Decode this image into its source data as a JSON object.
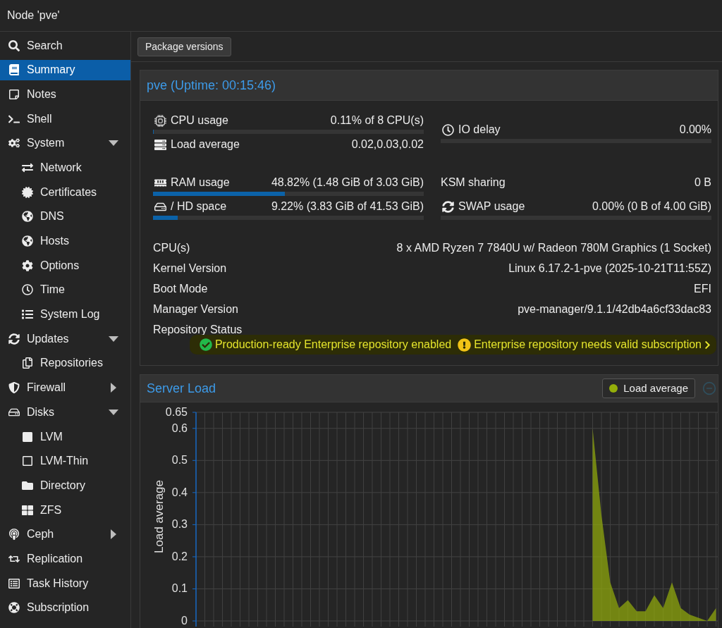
{
  "window": {
    "title": "Node 'pve'"
  },
  "sidebar": {
    "items": [
      {
        "label": "Search",
        "selected": false
      },
      {
        "label": "Summary",
        "selected": true
      },
      {
        "label": "Notes",
        "selected": false
      },
      {
        "label": "Shell",
        "selected": false
      },
      {
        "label": "System",
        "selected": false,
        "expanded": true,
        "children": [
          {
            "label": "Network",
            "selected": false
          },
          {
            "label": "Certificates",
            "selected": false
          },
          {
            "label": "DNS",
            "selected": false
          },
          {
            "label": "Hosts",
            "selected": false
          },
          {
            "label": "Options",
            "selected": false
          },
          {
            "label": "Time",
            "selected": false
          },
          {
            "label": "System Log",
            "selected": false
          }
        ]
      },
      {
        "label": "Updates",
        "selected": false,
        "expanded": true,
        "children": [
          {
            "label": "Repositories",
            "selected": false
          }
        ]
      },
      {
        "label": "Firewall",
        "selected": false,
        "expanded": false
      },
      {
        "label": "Disks",
        "selected": false,
        "expanded": true,
        "children": [
          {
            "label": "LVM",
            "selected": false
          },
          {
            "label": "LVM-Thin",
            "selected": false
          },
          {
            "label": "Directory",
            "selected": false
          },
          {
            "label": "ZFS",
            "selected": false
          }
        ]
      },
      {
        "label": "Ceph",
        "selected": false,
        "expanded": false
      },
      {
        "label": "Replication",
        "selected": false
      },
      {
        "label": "Task History",
        "selected": false
      },
      {
        "label": "Subscription",
        "selected": false
      }
    ]
  },
  "toolbar": {
    "buttons": [
      "Package versions"
    ]
  },
  "summary": {
    "title": "pve (Uptime: 00:15:46)",
    "metric_groups": [
      {
        "left": [
          {
            "label": "CPU usage",
            "value": "0.11% of 8 CPU(s)",
            "level": 0.0011
          },
          {
            "label": "Load average",
            "value": "0.02,0.03,0.02"
          }
        ],
        "right": [
          {
            "label": "IO delay",
            "value": "0.00%",
            "level": 0
          }
        ]
      },
      {
        "left": [
          {
            "label": "RAM usage",
            "value": "48.82% (1.48 GiB of 3.03 GiB)",
            "level": 0.4882
          },
          {
            "label": "/ HD space",
            "value": "9.22% (3.83 GiB of 41.53 GiB)",
            "level": 0.0922
          }
        ],
        "right": [
          {
            "label": "KSM sharing",
            "value": "0 B"
          },
          {
            "label": "SWAP usage",
            "value": "0.00% (0 B of 4.00 GiB)",
            "level": 0
          }
        ]
      }
    ],
    "details": [
      {
        "label": "CPU(s)",
        "value": "8 x AMD Ryzen 7 7840U w/ Radeon 780M Graphics (1 Socket)"
      },
      {
        "label": "Kernel Version",
        "value": "Linux 6.17.2-1-pve (2025-10-21T11:55Z)"
      },
      {
        "label": "Boot Mode",
        "value": "EFI"
      },
      {
        "label": "Manager Version",
        "value": "pve-manager/9.1.1/42db4a6cf33dac83"
      },
      {
        "label": "Repository Status"
      }
    ],
    "repository_status": [
      {
        "kind": "ok",
        "text": "Production-ready Enterprise repository enabled"
      },
      {
        "kind": "warning",
        "text": "Enterprise repository needs valid subscription"
      }
    ]
  },
  "server_load": {
    "chart_data": {
      "type": "area",
      "title": "Server Load",
      "ylabel": "Load average",
      "ylim": [
        0,
        0.65
      ],
      "yticks": [
        0,
        0.1,
        0.2,
        0.3,
        0.4,
        0.5,
        0.6,
        0.65
      ],
      "grid": true,
      "series": [
        {
          "name": "Load average",
          "color": "#94ae0a",
          "values": [
            null,
            null,
            null,
            null,
            null,
            null,
            null,
            null,
            null,
            null,
            null,
            null,
            null,
            null,
            null,
            null,
            null,
            null,
            null,
            null,
            null,
            null,
            null,
            null,
            null,
            null,
            null,
            null,
            null,
            null,
            null,
            null,
            null,
            null,
            null,
            null,
            null,
            null,
            null,
            null,
            null,
            null,
            null,
            null,
            null,
            0.6,
            0.33,
            0.12,
            0.04,
            0.065,
            0.03,
            0.03,
            0.08,
            0.04,
            0.12,
            0.04,
            0.02,
            0.01,
            0,
            0.04
          ]
        }
      ]
    }
  }
}
